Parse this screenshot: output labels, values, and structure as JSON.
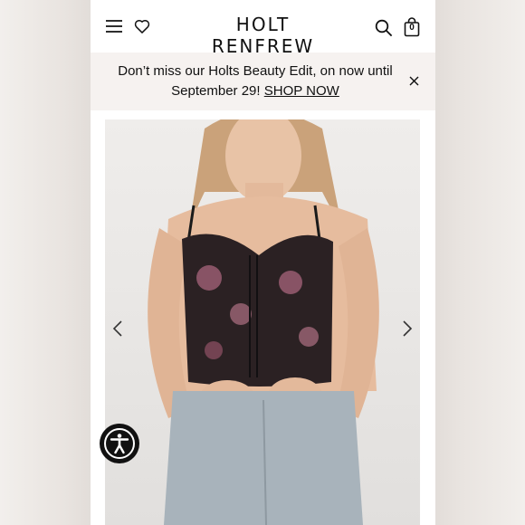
{
  "header": {
    "brand": "HOLT RENFREW",
    "bag_count": "0",
    "icons": [
      "menu-icon",
      "heart-icon",
      "search-icon",
      "shopping-bag-icon"
    ]
  },
  "promo": {
    "message": "Don’t miss our Holts Beauty Edit, on now until September 29!",
    "link_label": "SHOP NOW"
  },
  "gallery": {
    "icons": [
      "chevron-left-icon",
      "chevron-right-icon"
    ]
  },
  "accessibility": {
    "icon": "accessibility-icon"
  },
  "colors": {
    "background": "#ffffff",
    "promo_bar": "#f6f2f0",
    "text": "#111111",
    "accessibility_button": "#111111"
  }
}
